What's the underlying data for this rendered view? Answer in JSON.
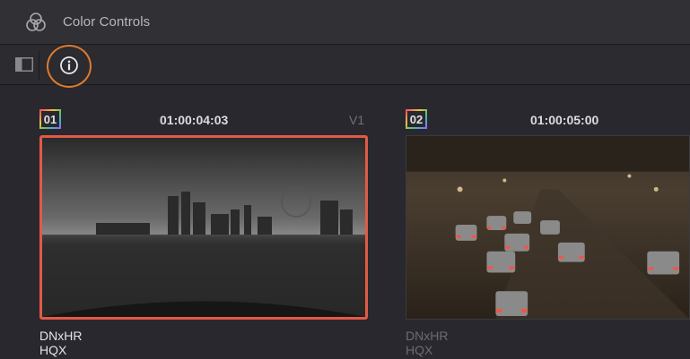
{
  "header": {
    "title": "Color Controls",
    "icon": "color-circles-icon"
  },
  "toolbar": {
    "sidebar_toggle_icon": "sidebar-toggle-icon",
    "info_icon": "info-icon",
    "highlight_color": "#e07b2c"
  },
  "clips": [
    {
      "number": "01",
      "timecode": "01:00:04:03",
      "track": "V1",
      "codec": "DNxHR HQX",
      "selected": true,
      "selection_color": "#e25a46"
    },
    {
      "number": "02",
      "timecode": "01:00:05:00",
      "track": "",
      "codec": "DNxHR HQX",
      "selected": false
    }
  ]
}
